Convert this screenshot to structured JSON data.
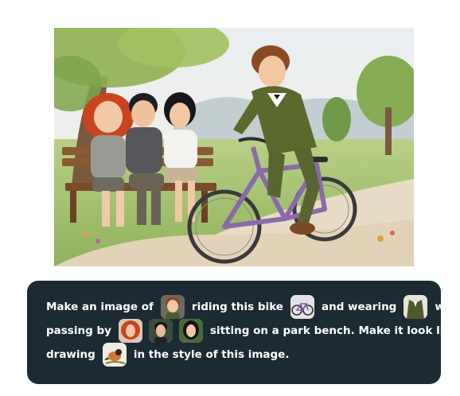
{
  "prompt": {
    "line1": {
      "t1": "Make an image of",
      "t2": "riding this bike",
      "t3": "and wearing",
      "t4": "while"
    },
    "line2": {
      "t1": "passing by",
      "t2": "sitting on a park bench. Make it look like a"
    },
    "line3": {
      "t1": "drawing",
      "t2": "in the style of this image."
    }
  },
  "chips": [
    {
      "icon": "boy-portrait-thumbnail"
    },
    {
      "icon": "bicycle-thumbnail"
    },
    {
      "icon": "suit-thumbnail"
    },
    {
      "icon": "redhead-girl-thumbnail"
    },
    {
      "icon": "dark-haired-boy-thumbnail"
    },
    {
      "icon": "dark-haired-girl-thumbnail"
    },
    {
      "icon": "watercolor-bird-thumbnail"
    }
  ],
  "colors": {
    "card_background": "#1c2a33",
    "card_text": "#ffffff"
  }
}
